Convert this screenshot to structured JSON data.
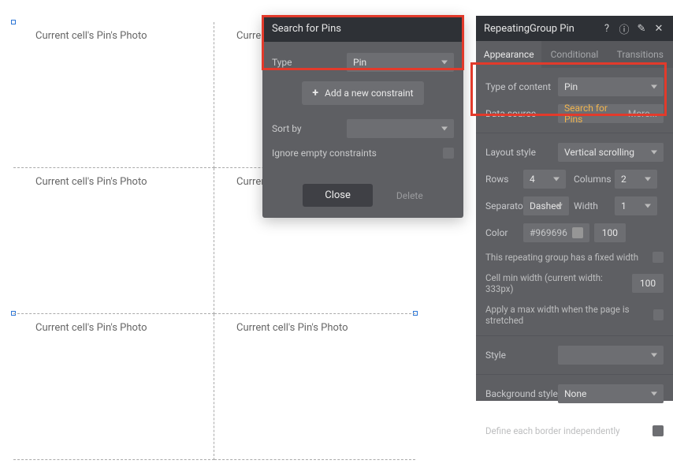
{
  "canvas": {
    "cell_label": "Current cell's Pin's Photo"
  },
  "popup": {
    "title": "Search for Pins",
    "type_label": "Type",
    "type_value": "Pin",
    "add_constraint": "Add a new constraint",
    "sort_by_label": "Sort by",
    "sort_by_value": "",
    "ignore_empty_label": "Ignore empty constraints",
    "close": "Close",
    "delete": "Delete"
  },
  "sidebar": {
    "title": "RepeatingGroup Pin",
    "tabs": {
      "appearance": "Appearance",
      "conditional": "Conditional",
      "transitions": "Transitions"
    },
    "content": {
      "type_of_content_label": "Type of content",
      "type_of_content_value": "Pin",
      "data_source_label": "Data source",
      "data_source_value": "Search for Pins",
      "data_source_more": "More..."
    },
    "layout": {
      "layout_style_label": "Layout style",
      "layout_style_value": "Vertical scrolling",
      "rows_label": "Rows",
      "rows_value": "4",
      "columns_label": "Columns",
      "columns_value": "2",
      "separator_label": "Separato",
      "separator_value": "Dashed",
      "width_label": "Width",
      "width_value": "1",
      "color_label": "Color",
      "color_hex": "#969696",
      "color_opacity": "100",
      "fixed_width_label": "This repeating group has a fixed width",
      "cell_min_width_label": "Cell min width (current width: 333px)",
      "cell_min_width_value": "100",
      "max_width_label": "Apply a max width when the page is stretched"
    },
    "style": {
      "style_label": "Style",
      "style_value": ""
    },
    "background": {
      "bg_style_label": "Background style",
      "bg_style_value": "None",
      "define_border_label": "Define each border independently"
    }
  }
}
